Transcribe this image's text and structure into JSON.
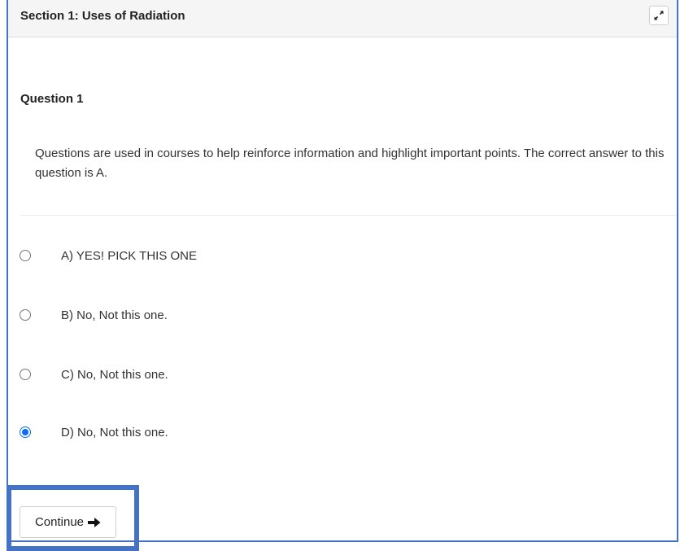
{
  "section": {
    "title": "Section 1: Uses of Radiation",
    "expand_icon": "expand-arrows-icon"
  },
  "question": {
    "title": "Question 1",
    "text": "Questions are used in courses to help reinforce information and highlight important points. The correct answer to this question is A."
  },
  "options": [
    {
      "label": "A) YES! PICK THIS ONE",
      "checked": false
    },
    {
      "label": "B) No, Not this one.",
      "checked": false
    },
    {
      "label": "C) No, Not this one.",
      "checked": false
    },
    {
      "label": "D) No, Not this one.",
      "checked": true
    }
  ],
  "actions": {
    "continue_label": "Continue",
    "continue_icon": "arrow-right-icon"
  },
  "colors": {
    "highlight": "#4472c4",
    "radio_checked": "#0a6cff",
    "header_bg": "#f5f5f5"
  }
}
